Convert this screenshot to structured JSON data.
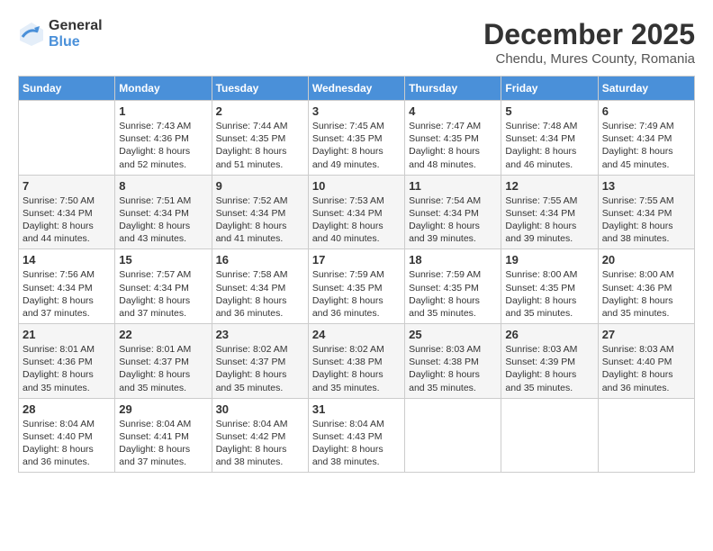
{
  "logo": {
    "general": "General",
    "blue": "Blue"
  },
  "title": "December 2025",
  "location": "Chendu, Mures County, Romania",
  "days_of_week": [
    "Sunday",
    "Monday",
    "Tuesday",
    "Wednesday",
    "Thursday",
    "Friday",
    "Saturday"
  ],
  "weeks": [
    [
      {
        "day": "",
        "sunrise": "",
        "sunset": "",
        "daylight": ""
      },
      {
        "day": "1",
        "sunrise": "Sunrise: 7:43 AM",
        "sunset": "Sunset: 4:36 PM",
        "daylight": "Daylight: 8 hours and 52 minutes."
      },
      {
        "day": "2",
        "sunrise": "Sunrise: 7:44 AM",
        "sunset": "Sunset: 4:35 PM",
        "daylight": "Daylight: 8 hours and 51 minutes."
      },
      {
        "day": "3",
        "sunrise": "Sunrise: 7:45 AM",
        "sunset": "Sunset: 4:35 PM",
        "daylight": "Daylight: 8 hours and 49 minutes."
      },
      {
        "day": "4",
        "sunrise": "Sunrise: 7:47 AM",
        "sunset": "Sunset: 4:35 PM",
        "daylight": "Daylight: 8 hours and 48 minutes."
      },
      {
        "day": "5",
        "sunrise": "Sunrise: 7:48 AM",
        "sunset": "Sunset: 4:34 PM",
        "daylight": "Daylight: 8 hours and 46 minutes."
      },
      {
        "day": "6",
        "sunrise": "Sunrise: 7:49 AM",
        "sunset": "Sunset: 4:34 PM",
        "daylight": "Daylight: 8 hours and 45 minutes."
      }
    ],
    [
      {
        "day": "7",
        "sunrise": "Sunrise: 7:50 AM",
        "sunset": "Sunset: 4:34 PM",
        "daylight": "Daylight: 8 hours and 44 minutes."
      },
      {
        "day": "8",
        "sunrise": "Sunrise: 7:51 AM",
        "sunset": "Sunset: 4:34 PM",
        "daylight": "Daylight: 8 hours and 43 minutes."
      },
      {
        "day": "9",
        "sunrise": "Sunrise: 7:52 AM",
        "sunset": "Sunset: 4:34 PM",
        "daylight": "Daylight: 8 hours and 41 minutes."
      },
      {
        "day": "10",
        "sunrise": "Sunrise: 7:53 AM",
        "sunset": "Sunset: 4:34 PM",
        "daylight": "Daylight: 8 hours and 40 minutes."
      },
      {
        "day": "11",
        "sunrise": "Sunrise: 7:54 AM",
        "sunset": "Sunset: 4:34 PM",
        "daylight": "Daylight: 8 hours and 39 minutes."
      },
      {
        "day": "12",
        "sunrise": "Sunrise: 7:55 AM",
        "sunset": "Sunset: 4:34 PM",
        "daylight": "Daylight: 8 hours and 39 minutes."
      },
      {
        "day": "13",
        "sunrise": "Sunrise: 7:55 AM",
        "sunset": "Sunset: 4:34 PM",
        "daylight": "Daylight: 8 hours and 38 minutes."
      }
    ],
    [
      {
        "day": "14",
        "sunrise": "Sunrise: 7:56 AM",
        "sunset": "Sunset: 4:34 PM",
        "daylight": "Daylight: 8 hours and 37 minutes."
      },
      {
        "day": "15",
        "sunrise": "Sunrise: 7:57 AM",
        "sunset": "Sunset: 4:34 PM",
        "daylight": "Daylight: 8 hours and 37 minutes."
      },
      {
        "day": "16",
        "sunrise": "Sunrise: 7:58 AM",
        "sunset": "Sunset: 4:34 PM",
        "daylight": "Daylight: 8 hours and 36 minutes."
      },
      {
        "day": "17",
        "sunrise": "Sunrise: 7:59 AM",
        "sunset": "Sunset: 4:35 PM",
        "daylight": "Daylight: 8 hours and 36 minutes."
      },
      {
        "day": "18",
        "sunrise": "Sunrise: 7:59 AM",
        "sunset": "Sunset: 4:35 PM",
        "daylight": "Daylight: 8 hours and 35 minutes."
      },
      {
        "day": "19",
        "sunrise": "Sunrise: 8:00 AM",
        "sunset": "Sunset: 4:35 PM",
        "daylight": "Daylight: 8 hours and 35 minutes."
      },
      {
        "day": "20",
        "sunrise": "Sunrise: 8:00 AM",
        "sunset": "Sunset: 4:36 PM",
        "daylight": "Daylight: 8 hours and 35 minutes."
      }
    ],
    [
      {
        "day": "21",
        "sunrise": "Sunrise: 8:01 AM",
        "sunset": "Sunset: 4:36 PM",
        "daylight": "Daylight: 8 hours and 35 minutes."
      },
      {
        "day": "22",
        "sunrise": "Sunrise: 8:01 AM",
        "sunset": "Sunset: 4:37 PM",
        "daylight": "Daylight: 8 hours and 35 minutes."
      },
      {
        "day": "23",
        "sunrise": "Sunrise: 8:02 AM",
        "sunset": "Sunset: 4:37 PM",
        "daylight": "Daylight: 8 hours and 35 minutes."
      },
      {
        "day": "24",
        "sunrise": "Sunrise: 8:02 AM",
        "sunset": "Sunset: 4:38 PM",
        "daylight": "Daylight: 8 hours and 35 minutes."
      },
      {
        "day": "25",
        "sunrise": "Sunrise: 8:03 AM",
        "sunset": "Sunset: 4:38 PM",
        "daylight": "Daylight: 8 hours and 35 minutes."
      },
      {
        "day": "26",
        "sunrise": "Sunrise: 8:03 AM",
        "sunset": "Sunset: 4:39 PM",
        "daylight": "Daylight: 8 hours and 35 minutes."
      },
      {
        "day": "27",
        "sunrise": "Sunrise: 8:03 AM",
        "sunset": "Sunset: 4:40 PM",
        "daylight": "Daylight: 8 hours and 36 minutes."
      }
    ],
    [
      {
        "day": "28",
        "sunrise": "Sunrise: 8:04 AM",
        "sunset": "Sunset: 4:40 PM",
        "daylight": "Daylight: 8 hours and 36 minutes."
      },
      {
        "day": "29",
        "sunrise": "Sunrise: 8:04 AM",
        "sunset": "Sunset: 4:41 PM",
        "daylight": "Daylight: 8 hours and 37 minutes."
      },
      {
        "day": "30",
        "sunrise": "Sunrise: 8:04 AM",
        "sunset": "Sunset: 4:42 PM",
        "daylight": "Daylight: 8 hours and 38 minutes."
      },
      {
        "day": "31",
        "sunrise": "Sunrise: 8:04 AM",
        "sunset": "Sunset: 4:43 PM",
        "daylight": "Daylight: 8 hours and 38 minutes."
      },
      {
        "day": "",
        "sunrise": "",
        "sunset": "",
        "daylight": ""
      },
      {
        "day": "",
        "sunrise": "",
        "sunset": "",
        "daylight": ""
      },
      {
        "day": "",
        "sunrise": "",
        "sunset": "",
        "daylight": ""
      }
    ]
  ]
}
